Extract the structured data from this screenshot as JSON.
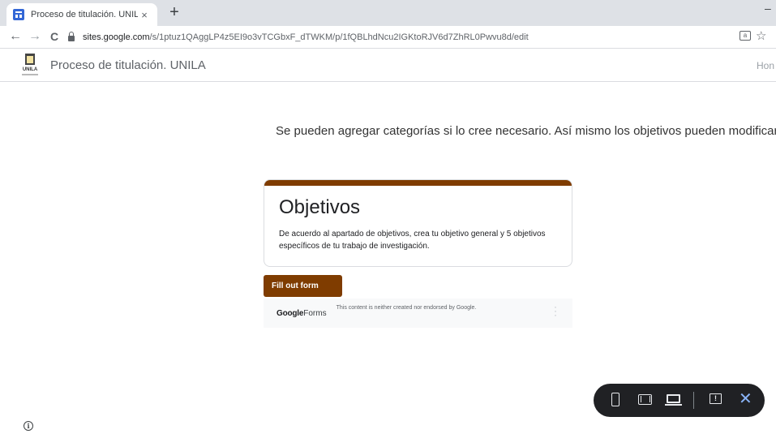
{
  "browser": {
    "tab_title": "Proceso de titulación. UNILA",
    "tab_close": "×",
    "new_tab": "+",
    "minimize": "–",
    "url_host": "sites.google.com",
    "url_path": "/s/1ptuz1QAggLP4z5EI9o3vTCGbxF_dTWKM/p/1fQBLhdNcu2IGKtoRJV6d7ZhRL0Pwvu8d/edit",
    "back": "←",
    "forward": "→",
    "reload": "C",
    "star": "☆",
    "icons": [
      "favicon-icon",
      "back-arrow-icon",
      "forward-arrow-icon",
      "reload-icon",
      "lock-icon",
      "translate-icon",
      "star-icon"
    ]
  },
  "site": {
    "logo_text": "UNILA",
    "title": "Proceso de titulación. UNILA",
    "nav_home": "Hon"
  },
  "content": {
    "intro": "Se pueden agregar categorías si lo cree necesario. Así mismo los objetivos pueden modificarse."
  },
  "form": {
    "title": "Objetivos",
    "description": "De acuerdo al apartado de objetivos, crea tu objetivo general y 5 objetivos específicos de tu trabajo de investigación.",
    "button": "Fill out form",
    "footer_brand_bold": "Google",
    "footer_brand": "Forms",
    "disclaimer": "This content is neither created nor endorsed by Google.",
    "more": "⋮",
    "accent_color": "#7f3c00"
  },
  "preview_toolbar": {
    "icons": [
      "phone-icon",
      "tablet-icon",
      "laptop-icon",
      "feedback-icon",
      "close-icon"
    ],
    "feedback_glyph": "!",
    "close_glyph": "✕",
    "close_color": "#8ab4f8"
  },
  "info": {
    "glyph": "i"
  }
}
